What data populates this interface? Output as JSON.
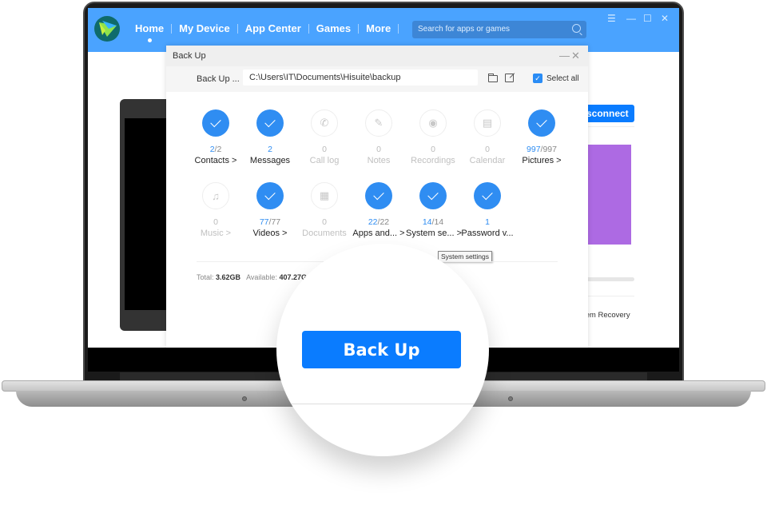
{
  "app": {
    "nav": [
      {
        "label": "Home",
        "active": true
      },
      {
        "label": "My Device"
      },
      {
        "label": "App Center"
      },
      {
        "label": "Games"
      },
      {
        "label": "More"
      }
    ],
    "search_placeholder": "Search for apps or games",
    "window_controls": {
      "menu": "☰",
      "minimize": "—",
      "maximize": "☐",
      "close": "✕"
    }
  },
  "background": {
    "disconnect_label": "sconnect",
    "recovery_label": "tem Recovery"
  },
  "dialog": {
    "title": "Back Up",
    "minimize": "—",
    "close": "✕",
    "path_label": "Back Up ...",
    "path_value": "C:\\Users\\IT\\Documents\\Hisuite\\backup",
    "select_all_label": "Select all",
    "select_all_checked": true,
    "items": [
      {
        "label": "Contacts >",
        "selected": "2",
        "total": "/2",
        "checked": true,
        "icon": "check"
      },
      {
        "label": "Messages",
        "selected": "2",
        "total": "",
        "checked": true,
        "icon": "check"
      },
      {
        "label": "Call log",
        "selected": "",
        "total": "0",
        "checked": false,
        "icon": "phone-icon"
      },
      {
        "label": "Notes",
        "selected": "",
        "total": "0",
        "checked": false,
        "icon": "notes-icon"
      },
      {
        "label": "Recordings",
        "selected": "",
        "total": "0",
        "checked": false,
        "icon": "recording-icon"
      },
      {
        "label": "Calendar",
        "selected": "",
        "total": "0",
        "checked": false,
        "icon": "calendar-icon"
      },
      {
        "label": "Pictures >",
        "selected": "997",
        "total": "/997",
        "checked": true,
        "icon": "check"
      },
      {
        "label": "Music >",
        "selected": "",
        "total": "0",
        "checked": false,
        "icon": "music-icon"
      },
      {
        "label": "Videos >",
        "selected": "77",
        "total": "/77",
        "checked": true,
        "icon": "check"
      },
      {
        "label": "Documents",
        "selected": "",
        "total": "0",
        "checked": false,
        "icon": "document-icon"
      },
      {
        "label": "Apps and... >",
        "selected": "22",
        "total": "/22",
        "checked": true,
        "icon": "check"
      },
      {
        "label": "System se... >",
        "selected": "14",
        "total": "/14",
        "checked": true,
        "icon": "check"
      },
      {
        "label": "Password v...",
        "selected": "1",
        "total": "",
        "checked": true,
        "icon": "check"
      }
    ],
    "tooltip": "System settings",
    "storage": {
      "total_label": "Total:",
      "total_value": "3.62GB",
      "available_label": "Available:",
      "available_value": "407.27G"
    }
  },
  "backup_button_label": "Back Up",
  "colors": {
    "header": "#4aa3ff",
    "accent": "#2f8df2",
    "button": "#0a7cff"
  }
}
